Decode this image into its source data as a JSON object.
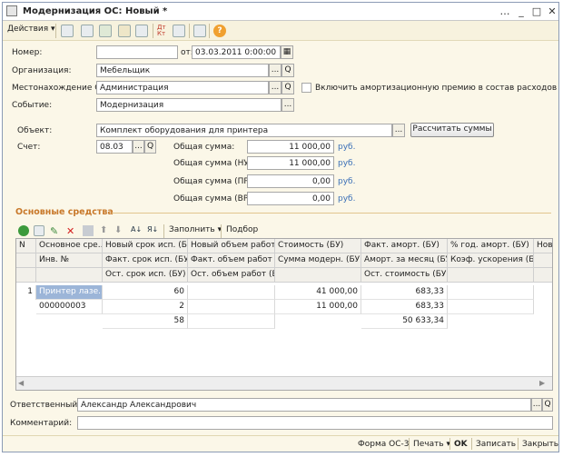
{
  "window": {
    "title": "Модернизация ОС: Новый *"
  },
  "toolbar": {
    "actions_label": "Действия"
  },
  "form": {
    "number_label": "Номер:",
    "number_value": "",
    "date_label": "от:",
    "date_value": "03.03.2011  0:00:00",
    "org_label": "Организация:",
    "org_value": "Мебельщик",
    "location_label": "Местонахождение ОС:",
    "location_value": "Администрация",
    "include_bonus_label": "Включить амортизационную премию в состав расходов",
    "event_label": "Событие:",
    "event_value": "Модернизация",
    "object_label": "Объект:",
    "object_value": "Комплект оборудования для принтера",
    "calc_button": "Рассчитать суммы",
    "account_label": "Счет:",
    "account_value": "08.03",
    "sum_label": "Общая сумма:",
    "sum_value": "11 000,00",
    "sum_nu_label": "Общая сумма (НУ):",
    "sum_nu_value": "11 000,00",
    "sum_pr_label": "Общая сумма (ПР):",
    "sum_pr_value": "0,00",
    "sum_vr_label": "Общая сумма (ВР):",
    "sum_vr_value": "0,00",
    "currency": "руб.",
    "ellipsis": "...",
    "search_glyph": "Q"
  },
  "section": {
    "title": "Основные средства"
  },
  "grid_toolbar": {
    "fill_label": "Заполнить",
    "select_label": "Подбор"
  },
  "grid": {
    "headers_row1": [
      "N",
      "Основное сре...",
      "Новый срок исп. (БУ)",
      "Новый объем работ...",
      "Стоимость (БУ)",
      "Факт. аморт. (БУ)",
      "% год. аморт. (БУ)",
      "Нов"
    ],
    "headers_row2": [
      "",
      "Инв. №",
      "Факт. срок исп. (БУ)",
      "Факт. объем работ ...",
      "Сумма модерн. (БУ)",
      "Аморт. за месяц (БУ)",
      "Коэф. ускорения (БУ)",
      ""
    ],
    "headers_row3": [
      "",
      "",
      "Ост. срок исп. (БУ)",
      "Ост. объем работ (Б...",
      "",
      "Ост. стоимость (БУ)",
      "",
      ""
    ],
    "row": {
      "n": "1",
      "asset": "Принтер лазе...",
      "inv": "000000003",
      "new_term": "60",
      "fact_term": "2",
      "rest_term": "58",
      "cost": "41 000,00",
      "modern_sum": "11 000,00",
      "fact_amort": "683,33",
      "monthly_amort": "683,33",
      "rest_cost": "50 633,34"
    }
  },
  "responsible": {
    "label": "Ответственный:",
    "value": "Александр Александрович"
  },
  "comment": {
    "label": "Комментарий:",
    "value": ""
  },
  "footer": {
    "form_label": "Форма ОС-3",
    "print_label": "Печать",
    "ok_label": "OK",
    "save_label": "Записать",
    "close_label": "Закрыть"
  }
}
